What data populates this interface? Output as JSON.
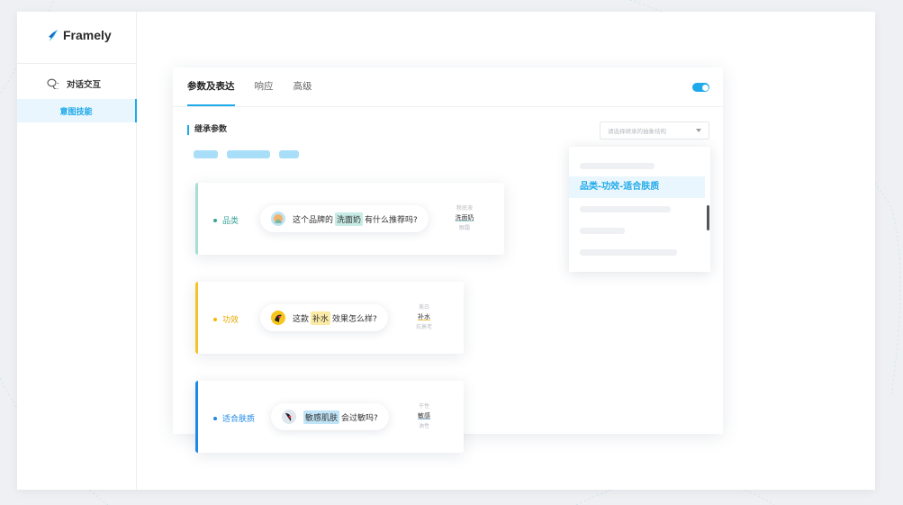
{
  "app": {
    "name": "Framely"
  },
  "sidebar": {
    "group_label": "对话交互",
    "sub_item": "意图技能"
  },
  "tabs": [
    {
      "label": "参数及表达",
      "active": true
    },
    {
      "label": "响应",
      "active": false
    },
    {
      "label": "高级",
      "active": false
    }
  ],
  "toggle": {
    "on": true
  },
  "section": {
    "title": "继承参数"
  },
  "select": {
    "placeholder": "请选择继承的抽象结构"
  },
  "dropdown": {
    "selected": "品类-功效-适合肤质"
  },
  "cards": [
    {
      "label": "品类",
      "color": "#6cc3b8",
      "q_before": "这个品牌的",
      "q_highlight": "洗面奶",
      "q_after": "有什么推荐吗?",
      "hl_bg": "#c7ece5",
      "syn": [
        "粉底液",
        "洗面奶",
        "眼霜"
      ]
    },
    {
      "label": "功效",
      "color": "#f5c327",
      "q_before": "这款",
      "q_highlight": "补水",
      "q_after": "效果怎么样?",
      "hl_bg": "#fbe9a6",
      "syn": [
        "美白",
        "补水",
        "抗衰老"
      ]
    },
    {
      "label": "适合肤质",
      "color": "#1e88e5",
      "q_before": "",
      "q_highlight": "敏感肌肤",
      "q_after": "会过敏吗?",
      "hl_bg": "#bfe4f7",
      "syn": [
        "干性",
        "敏感",
        "油性"
      ]
    }
  ],
  "colors": {
    "accent": "#1ea9ea"
  }
}
